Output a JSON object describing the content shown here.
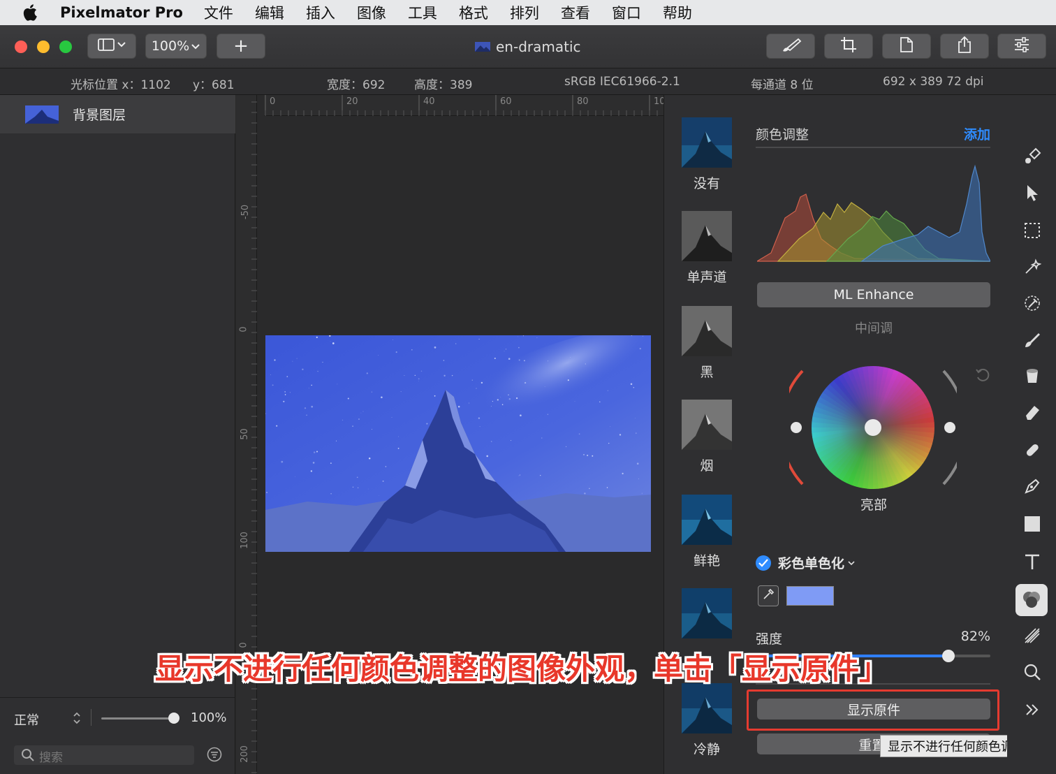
{
  "menubar": {
    "app_name": "Pixelmator Pro",
    "items": [
      "文件",
      "编辑",
      "插入",
      "图像",
      "工具",
      "格式",
      "排列",
      "查看",
      "窗口",
      "帮助"
    ]
  },
  "toolbar": {
    "zoom": "100%",
    "add_label": "+",
    "doc_title": "en-dramatic"
  },
  "infobar": {
    "cursor_x": "光标位置 x：1102",
    "cursor_y": "y：681",
    "width": "宽度：692",
    "height": "高度：389",
    "profile": "sRGB IEC61966-2.1",
    "depth": "每通道 8 位",
    "size": "692 x 389 72 dpi"
  },
  "layers": {
    "layer_name": "背景图层",
    "blend_mode": "正常",
    "opacity": "100%",
    "opacity_fraction": 1.0,
    "search_placeholder": "搜索"
  },
  "rulers": {
    "h_labels": [
      "0",
      "20",
      "40",
      "60",
      "80",
      "10"
    ],
    "v_labels": [
      "-50",
      "0",
      "50",
      "100",
      "0",
      "200"
    ]
  },
  "presets": [
    "没有",
    "单声道",
    "黑",
    "烟",
    "鲜艳",
    "",
    "冷静"
  ],
  "adjust": {
    "title": "颜色调整",
    "add_label": "添加",
    "ml_enhance": "ML Enhance",
    "midtones": "中间调",
    "highlights": "亮部",
    "mono_label": "彩色单色化",
    "mono_color": "#7f9bf5",
    "strength_label": "强度",
    "strength_value": "82%",
    "strength_fraction": 0.82,
    "show_original": "显示原件",
    "reset_label": "重置i",
    "tooltip": "显示不进行任何颜色调整的对象"
  },
  "caption": "显示不进行任何颜色调整的图像外观，单击「显示原件」",
  "colors": {
    "accent": "#2f8cff",
    "highlight_red": "#e53b30"
  }
}
